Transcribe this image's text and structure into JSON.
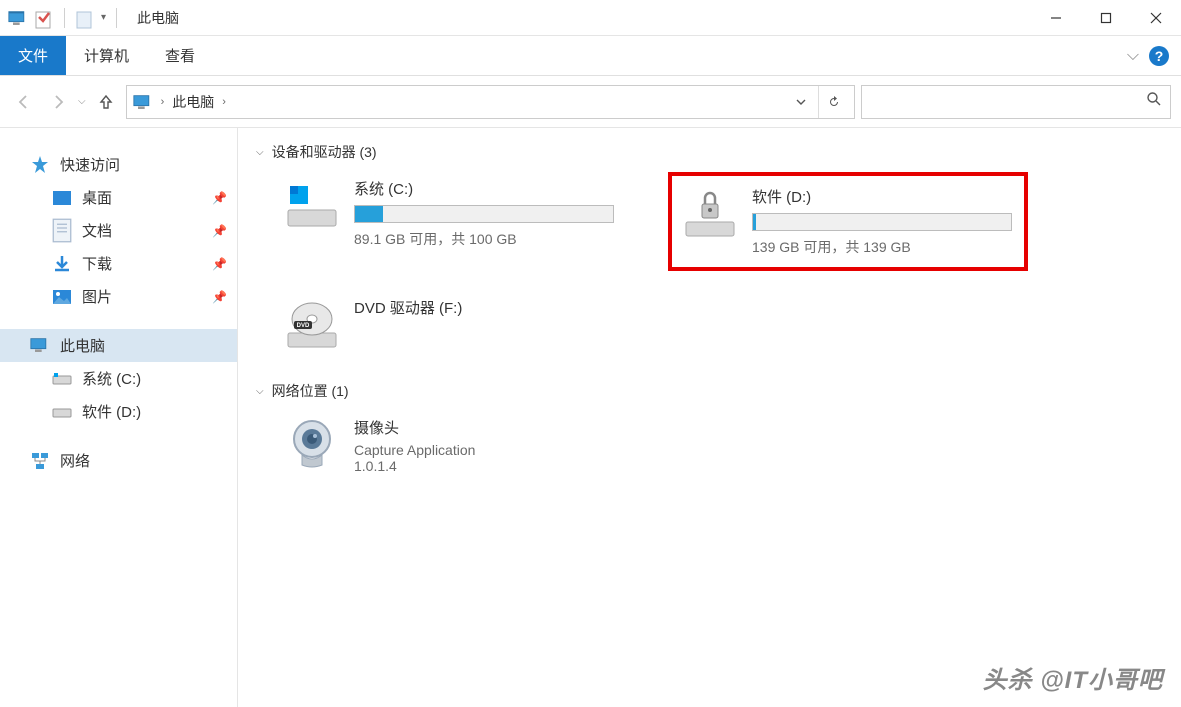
{
  "window": {
    "title": "此电脑"
  },
  "ribbon": {
    "file": "文件",
    "computer": "计算机",
    "view": "查看"
  },
  "breadcrumb": {
    "root": "此电脑",
    "sep": "›"
  },
  "sidebar": {
    "quickAccess": "快速访问",
    "items": [
      {
        "label": "桌面"
      },
      {
        "label": "文档"
      },
      {
        "label": "下载"
      },
      {
        "label": "图片"
      }
    ],
    "thisPC": "此电脑",
    "drives": [
      {
        "label": "系统 (C:)"
      },
      {
        "label": "软件 (D:)"
      }
    ],
    "network": "网络"
  },
  "sections": {
    "devices": "设备和驱动器 (3)",
    "network": "网络位置 (1)"
  },
  "drives": {
    "c": {
      "title": "系统 (C:)",
      "status": "89.1 GB 可用，共 100 GB",
      "fillPct": "11%"
    },
    "d": {
      "title": "软件 (D:)",
      "status": "139 GB 可用，共 139 GB",
      "fillPct": "1%"
    },
    "dvd": {
      "title": "DVD 驱动器 (F:)"
    }
  },
  "networkItems": {
    "cam": {
      "title": "摄像头",
      "sub1": "Capture Application",
      "sub2": "1.0.1.4"
    }
  },
  "watermark": "头杀 @IT小哥吧"
}
